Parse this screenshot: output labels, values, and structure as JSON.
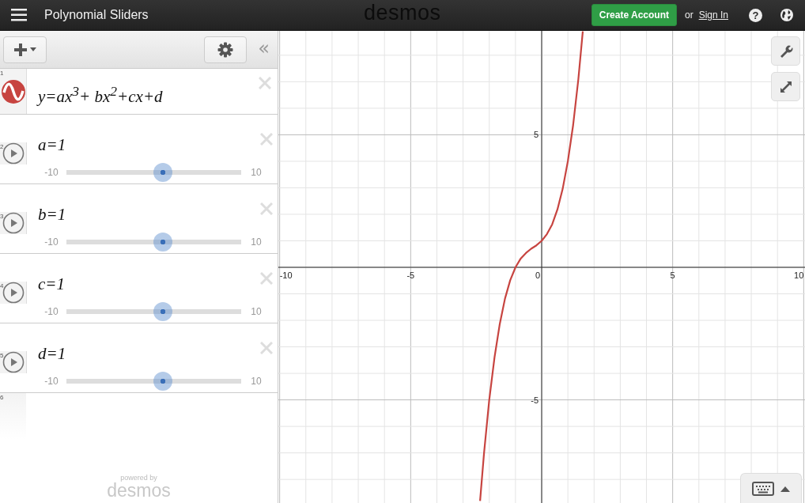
{
  "header": {
    "title": "Polynomial Sliders",
    "logo": "desmos",
    "create_account": "Create Account",
    "or": "or",
    "sign_in": "Sign In",
    "help": "?"
  },
  "toolbar": {
    "collapse": "«"
  },
  "expressions": [
    {
      "number": "1",
      "kind": "function",
      "latex": "y=ax$^{3}$+ bx$^{2}$+cx+d",
      "color": "#c74440"
    },
    {
      "number": "2",
      "kind": "slider",
      "latex": "a=1",
      "min": "-10",
      "max": "10",
      "level": 0.55
    },
    {
      "number": "3",
      "kind": "slider",
      "latex": "b=1",
      "min": "-10",
      "max": "10",
      "level": 0.55
    },
    {
      "number": "4",
      "kind": "slider",
      "latex": "c=1",
      "min": "-10",
      "max": "10",
      "level": 0.55
    },
    {
      "number": "5",
      "kind": "slider",
      "latex": "d=1",
      "min": "-10",
      "max": "10",
      "level": 0.55
    },
    {
      "number": "6",
      "kind": "empty"
    }
  ],
  "footer": {
    "powered_by": "powered by",
    "logo": "desmos"
  },
  "graph": {
    "chart_data": {
      "type": "line",
      "grid": true,
      "xlim": [
        -10.05,
        10.05
      ],
      "ylim": [
        -8.92,
        8.92
      ],
      "xticks": [
        -10,
        -5,
        0,
        5,
        10
      ],
      "yticks": [
        -5,
        5
      ],
      "x": [
        -2.35,
        -2.2,
        -2.0,
        -1.8,
        -1.6,
        -1.4,
        -1.2,
        -1.0,
        -0.8,
        -0.6,
        -0.4,
        -0.2,
        0,
        0.2,
        0.4,
        0.6,
        0.8,
        1.0,
        1.2,
        1.4,
        1.57
      ],
      "series": [
        {
          "color": "#c74440",
          "values": [
            -8.81,
            -7.01,
            -5,
            -3.39,
            -2.14,
            -1.18,
            -0.49,
            0,
            0.33,
            0.54,
            0.7,
            0.83,
            1,
            1.25,
            1.62,
            2.18,
            2.95,
            4,
            5.37,
            7.1,
            8.9
          ]
        }
      ]
    }
  }
}
